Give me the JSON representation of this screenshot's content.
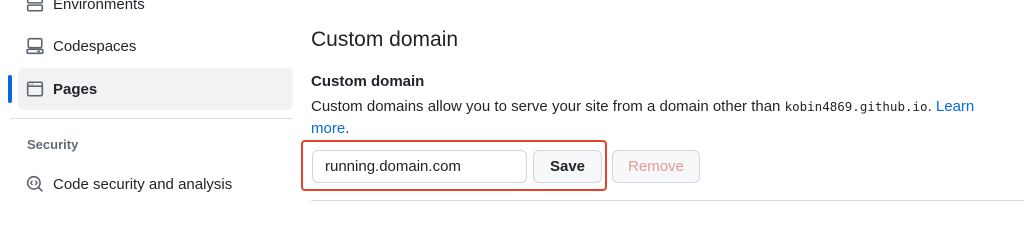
{
  "sidebar": {
    "items": [
      {
        "label": "Environments",
        "icon": "server-icon"
      },
      {
        "label": "Codespaces",
        "icon": "codespaces-icon"
      },
      {
        "label": "Pages",
        "icon": "browser-icon",
        "active": true
      }
    ],
    "security_heading": "Security",
    "security_items": [
      {
        "label": "Code security and analysis",
        "icon": "codescan-icon"
      }
    ]
  },
  "main": {
    "title": "Custom domain",
    "field_title": "Custom domain",
    "description_prefix": "Custom domains allow you to serve your site from a domain other than ",
    "description_domain": "kobin4869.github.io",
    "description_suffix": ".",
    "learn_more": "Learn more",
    "domain_value": "running.domain.com",
    "save_label": "Save",
    "remove_label": "Remove"
  },
  "colors": {
    "accent": "#0969da",
    "highlight": "#e5422b",
    "remove_disabled": "#e49a95"
  }
}
